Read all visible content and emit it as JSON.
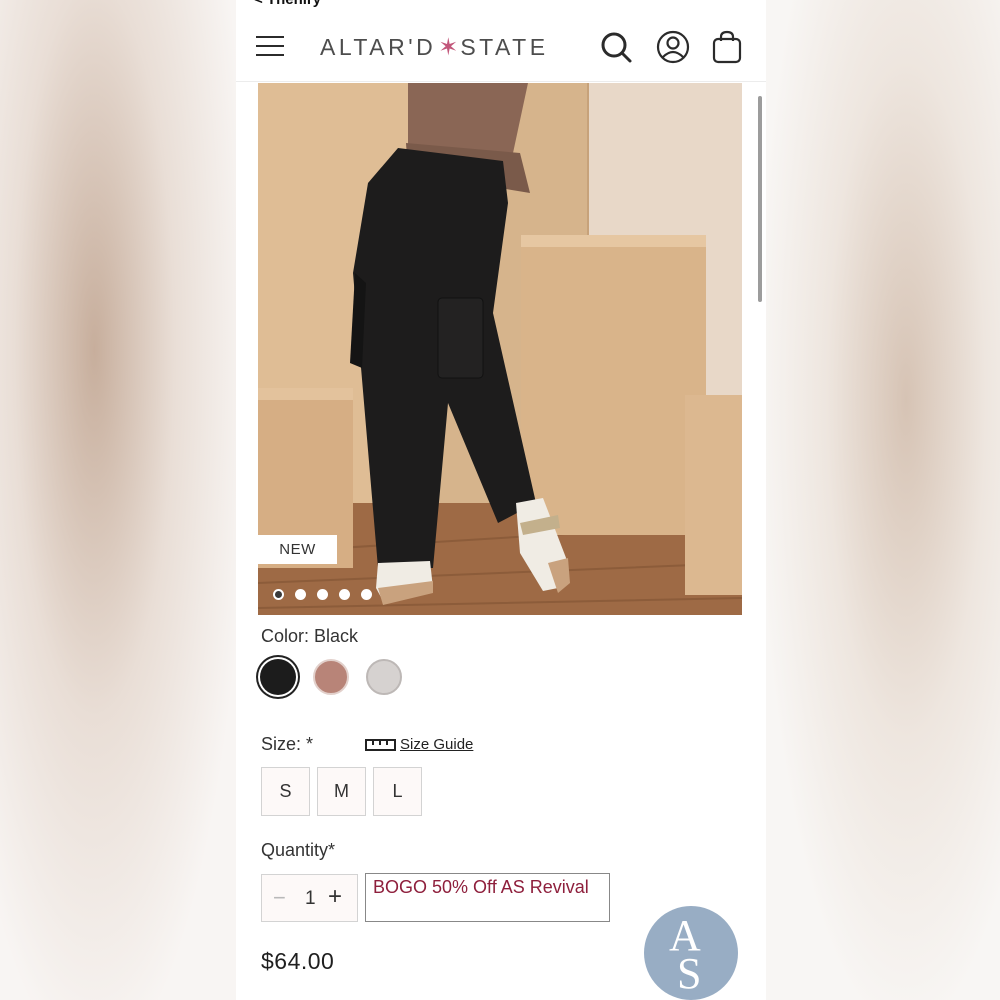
{
  "nav": {
    "back_label": "< Thehiry"
  },
  "header": {
    "logo_left": "ALTAR'D",
    "logo_star": "✶",
    "logo_right": "STATE",
    "icons": [
      "menu-icon",
      "search-icon",
      "account-icon",
      "shopping-bag-icon"
    ]
  },
  "product": {
    "badge": "NEW",
    "image_count": 5,
    "active_image": 1,
    "color_label": "Color: Black",
    "colors": [
      {
        "name": "Black",
        "hex": "#1c1c1c",
        "selected": true
      },
      {
        "name": "Mauve",
        "hex": "#b88478",
        "selected": false
      },
      {
        "name": "Heather Grey",
        "hex": "#d6d2d0",
        "selected": false
      }
    ],
    "size_label": "Size: *",
    "size_guide": "Size Guide",
    "sizes": [
      "S",
      "M",
      "L"
    ],
    "quantity_label": "Quantity*",
    "quantity": "1",
    "promo": "BOGO 50% Off AS Revival",
    "price": "$64.00"
  },
  "badge": {
    "letter1": "A",
    "letter2": "S",
    "color": "#98adc4"
  }
}
